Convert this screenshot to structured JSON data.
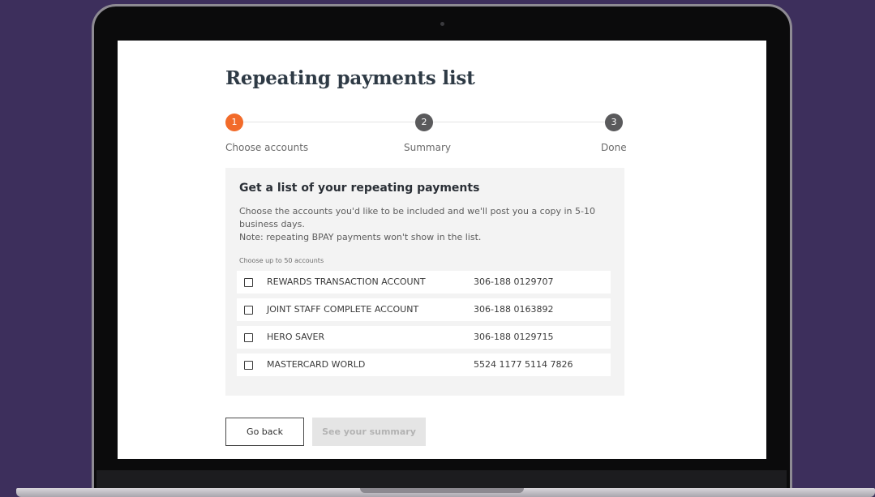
{
  "page": {
    "title": "Repeating payments list"
  },
  "stepper": {
    "steps": [
      {
        "number": "1",
        "label": "Choose accounts",
        "state": "active"
      },
      {
        "number": "2",
        "label": "Summary",
        "state": "inactive"
      },
      {
        "number": "3",
        "label": "Done",
        "state": "inactive"
      }
    ]
  },
  "panel": {
    "heading": "Get a list of your repeating payments",
    "description_line1": "Choose the accounts you'd like to be included and we'll post you a copy in 5-10 business days.",
    "description_line2": "Note: repeating BPAY payments won't show in the list.",
    "limit_hint": "Choose up to 50 accounts",
    "accounts": [
      {
        "name": "REWARDS TRANSACTION ACCOUNT",
        "number": "306-188 0129707",
        "checked": false
      },
      {
        "name": "JOINT STAFF COMPLETE ACCOUNT",
        "number": "306-188 0163892",
        "checked": false
      },
      {
        "name": "HERO SAVER",
        "number": "306-188 0129715",
        "checked": false
      },
      {
        "name": "MASTERCARD WORLD",
        "number": "5524 1177 5114 7826",
        "checked": false
      }
    ]
  },
  "actions": {
    "back_label": "Go back",
    "summary_label": "See your summary"
  },
  "colors": {
    "accent": "#f26b2a",
    "background": "#3d2f5c",
    "step_inactive": "#5a5a5c",
    "panel_bg": "#f3f3f3"
  }
}
